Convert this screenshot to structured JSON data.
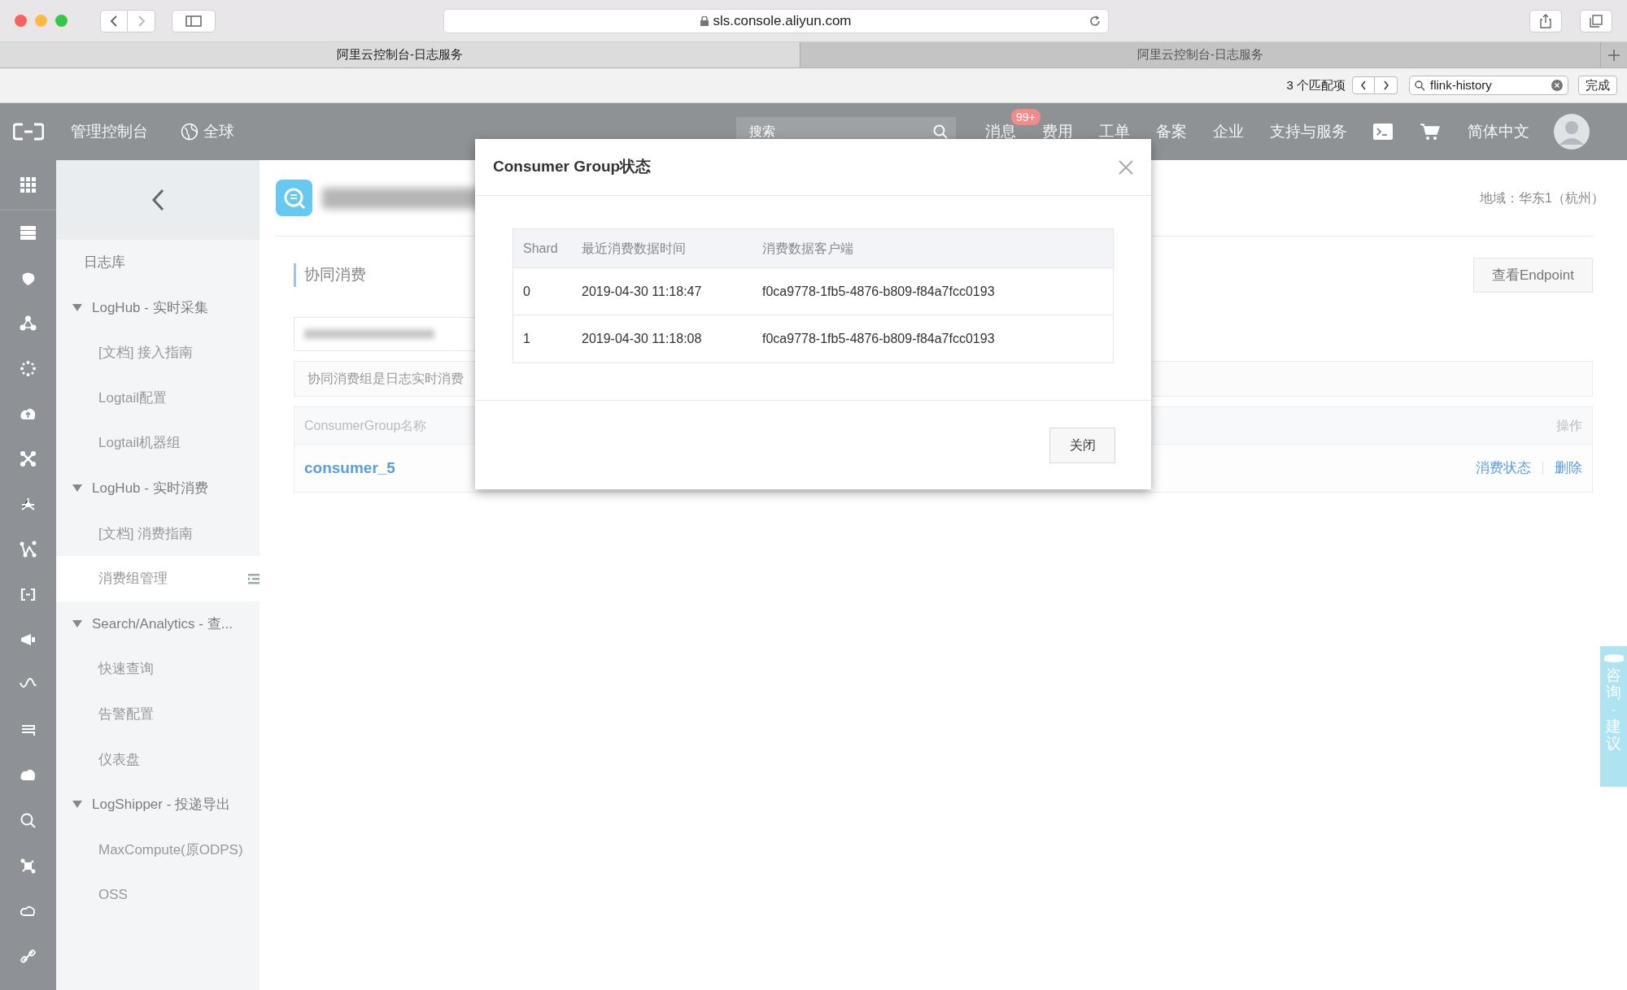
{
  "browser": {
    "url": "sls.console.aliyun.com",
    "tabs": [
      {
        "label": "阿里云控制台-日志服务",
        "selected": true
      },
      {
        "label": "阿里云控制台-日志服务",
        "selected": false
      }
    ],
    "find_bar": {
      "count": "3 个匹配项",
      "query": "flink-history",
      "done": "完成"
    }
  },
  "topbar": {
    "console": "管理控制台",
    "region": "全球",
    "search_placeholder": "搜索",
    "items": [
      {
        "label": "消息",
        "badge": "99+"
      },
      {
        "label": "费用"
      },
      {
        "label": "工单"
      },
      {
        "label": "备案"
      },
      {
        "label": "企业"
      },
      {
        "label": "支持与服务"
      }
    ],
    "language": "简体中文"
  },
  "sidebar": {
    "items": [
      {
        "label": "日志库",
        "selected": false
      },
      {
        "label": "LogHub - 实时采集",
        "selected": false,
        "expanded": true,
        "children": [
          {
            "label": "[文档] 接入指南",
            "selected": false
          },
          {
            "label": "Logtail配置",
            "selected": false
          },
          {
            "label": "Logtail机器组",
            "selected": false
          }
        ]
      },
      {
        "label": "LogHub - 实时消费",
        "selected": false,
        "expanded": true,
        "children": [
          {
            "label": "[文档] 消费指南",
            "selected": false
          },
          {
            "label": "消费组管理",
            "selected": true
          }
        ]
      },
      {
        "label": "Search/Analytics - 查...",
        "selected": false,
        "expanded": true,
        "children": [
          {
            "label": "快速查询",
            "selected": false
          },
          {
            "label": "告警配置",
            "selected": false
          },
          {
            "label": "仪表盘",
            "selected": false
          }
        ]
      },
      {
        "label": "LogShipper - 投递导出",
        "selected": false,
        "expanded": true,
        "children": [
          {
            "label": "MaxCompute(原ODPS)",
            "selected": false
          },
          {
            "label": "OSS",
            "selected": false
          }
        ]
      }
    ]
  },
  "page": {
    "region": "地域：华东1（杭州）",
    "section_title": "协同消费",
    "endpoint_button": "查看Endpoint",
    "notice": "协同消费组是日志实时消费",
    "table": {
      "columns": [
        "ConsumerGroup名称",
        "操作"
      ],
      "rows": [
        {
          "name": "consumer_5",
          "actions": [
            "消费状态",
            "删除"
          ]
        }
      ]
    }
  },
  "modal": {
    "title": "Consumer Group状态",
    "columns": [
      "Shard",
      "最近消费数据时间",
      "消费数据客户端"
    ],
    "rows": [
      [
        "0",
        "2019-04-30 11:18:47",
        "f0ca9778-1fb5-4876-b809-f84a7fcc0193"
      ],
      [
        "1",
        "2019-04-30 11:18:08",
        "f0ca9778-1fb5-4876-b809-f84a7fcc0193"
      ]
    ],
    "close_button": "关闭"
  },
  "feedback_tab": "咨询·建议"
}
